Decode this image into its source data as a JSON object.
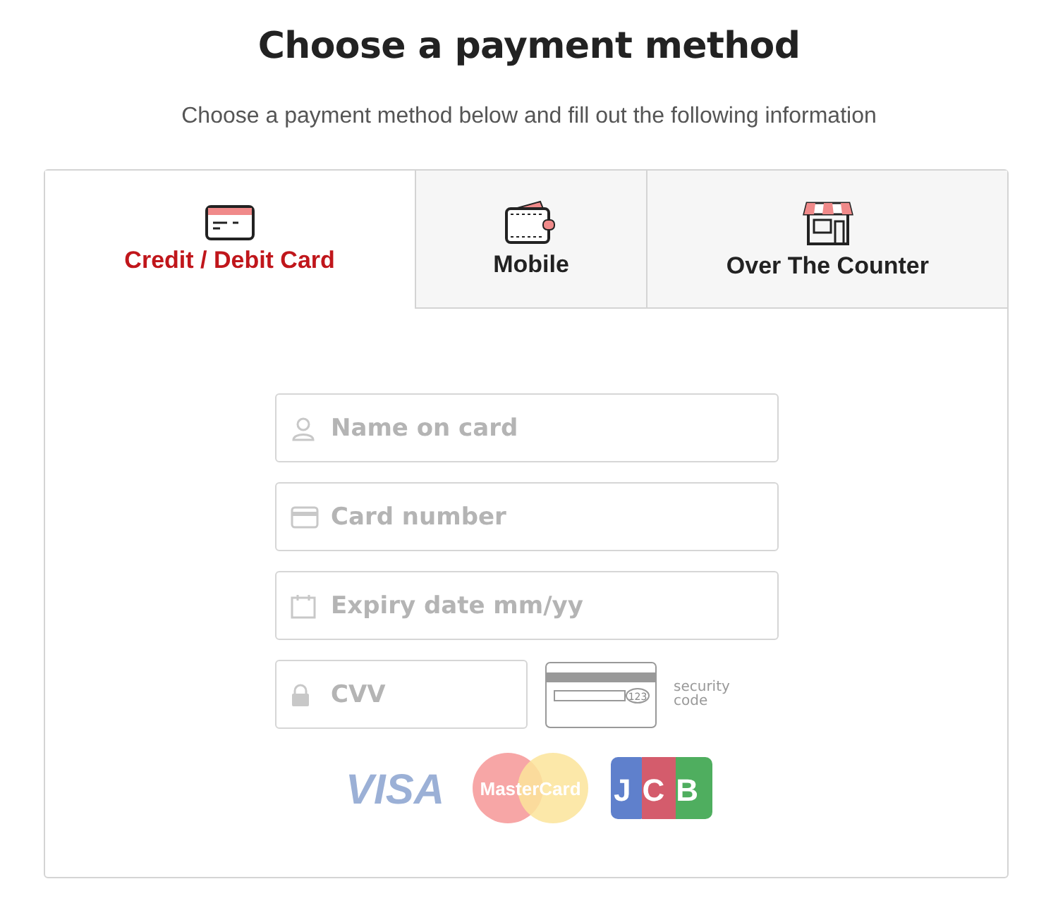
{
  "title": "Choose a payment method",
  "subtitle": "Choose a payment method below and fill out the following information",
  "tabs": [
    {
      "label": "Credit / Debit Card",
      "kind": "card",
      "selected": true
    },
    {
      "label": "Mobile",
      "kind": "wallet",
      "selected": false
    },
    {
      "label": "Over The Counter",
      "kind": "store",
      "selected": false
    }
  ],
  "fields": [
    {
      "placeholder": "Name on card",
      "kind": "person"
    },
    {
      "placeholder": "Card number",
      "kind": "card"
    },
    {
      "placeholder": "Expiry date mm/yy",
      "kind": "calendar"
    }
  ],
  "cvv": {
    "placeholder": "CVV",
    "kind": "lock"
  },
  "security_hint": {
    "number": "123",
    "label": "security code"
  },
  "card_logos": [
    {
      "text": "VISA",
      "kind": "visa"
    },
    {
      "text": "MasterCard",
      "kind": "mastercard"
    },
    {
      "text": "JCB",
      "kind": "jcb"
    }
  ]
}
